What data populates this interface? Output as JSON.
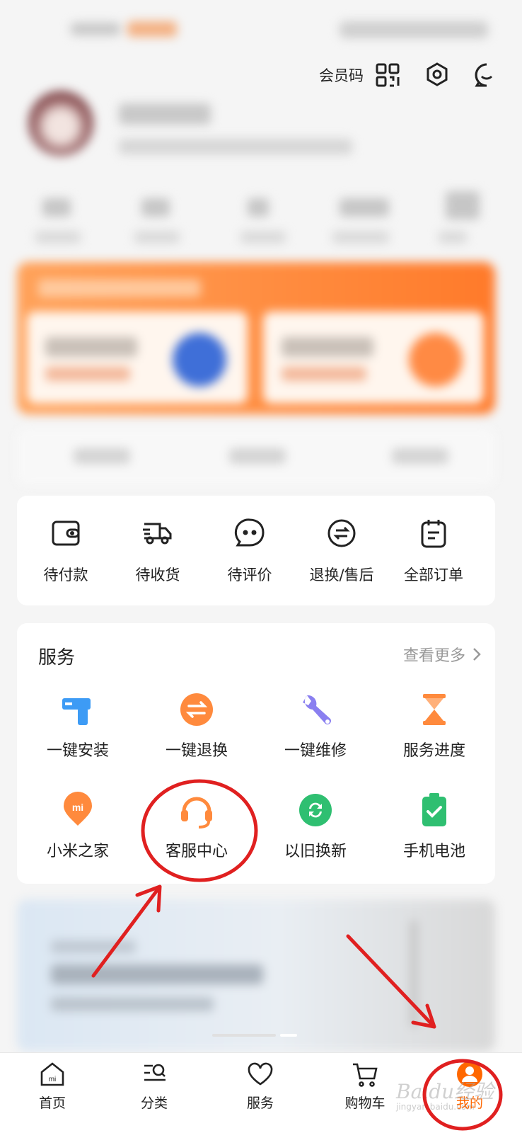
{
  "header": {
    "member_code_label": "会员码"
  },
  "orders": {
    "items": [
      {
        "label": "待付款",
        "icon": "wallet-icon"
      },
      {
        "label": "待收货",
        "icon": "delivery-truck-icon"
      },
      {
        "label": "待评价",
        "icon": "chat-bubble-icon"
      },
      {
        "label": "退换/售后",
        "icon": "exchange-icon"
      },
      {
        "label": "全部订单",
        "icon": "clipboard-icon"
      }
    ]
  },
  "services": {
    "title": "服务",
    "more_label": "查看更多",
    "items": [
      {
        "label": "一键安装",
        "icon": "drill-icon",
        "color": "#3d9bf5"
      },
      {
        "label": "一键退换",
        "icon": "swap-icon",
        "color": "#ff8a3d"
      },
      {
        "label": "一键维修",
        "icon": "wrench-icon",
        "color": "#8a7ff0"
      },
      {
        "label": "服务进度",
        "icon": "hourglass-icon",
        "color": "#ff8a3d"
      },
      {
        "label": "小米之家",
        "icon": "mi-store-icon",
        "color": "#ff8a3d"
      },
      {
        "label": "客服中心",
        "icon": "headset-icon",
        "color": "#ff8a3d"
      },
      {
        "label": "以旧换新",
        "icon": "refresh-icon",
        "color": "#2fbf71"
      },
      {
        "label": "手机电池",
        "icon": "battery-icon",
        "color": "#2fbf71"
      }
    ]
  },
  "bottom_nav": {
    "items": [
      {
        "label": "首页",
        "icon": "home-icon"
      },
      {
        "label": "分类",
        "icon": "category-search-icon"
      },
      {
        "label": "服务",
        "icon": "heart-icon"
      },
      {
        "label": "购物车",
        "icon": "cart-icon"
      },
      {
        "label": "我的",
        "icon": "profile-icon",
        "active": true
      }
    ]
  },
  "watermark": {
    "text": "Baidu经验",
    "sub": "jingyan.baidu.com"
  },
  "colors": {
    "accent": "#ff6700",
    "annotation_red": "#e02020"
  }
}
